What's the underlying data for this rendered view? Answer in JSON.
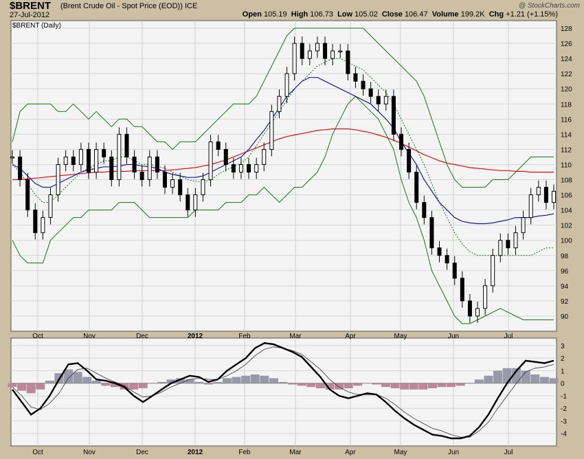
{
  "header": {
    "symbol": "$BRENT",
    "description": "(Brent Crude Oil - Spot Price (EOD))",
    "exchange": "ICE",
    "date": "27-Jul-2012",
    "open_label": "Open",
    "open": "105.19",
    "high_label": "High",
    "high": "106.73",
    "low_label": "Low",
    "low": "105.02",
    "close_label": "Close",
    "close": "106.47",
    "volume_label": "Volume",
    "volume": "199.2K",
    "chg_label": "Chg",
    "chg": "+1.21 (+1.15%)",
    "logo": "@ StockCharts.com"
  },
  "chart_data": [
    {
      "type": "line",
      "legend_label": "$BRENT (Daily)",
      "x_labels": [
        "Oct",
        "Nov",
        "Dec",
        "2012",
        "Feb",
        "Mar",
        "Apr",
        "May",
        "Jun",
        "Jul"
      ],
      "ylim": [
        88,
        129
      ],
      "y_ticks": [
        90,
        92,
        94,
        96,
        98,
        100,
        102,
        104,
        106,
        108,
        110,
        112,
        114,
        116,
        118,
        120,
        122,
        124,
        126,
        128
      ],
      "grid": true,
      "series": [
        {
          "role": "price",
          "values": [
            111,
            108,
            104,
            101,
            103,
            106,
            110,
            111,
            110,
            112,
            109,
            112,
            111,
            108,
            114,
            111,
            109,
            108,
            111,
            109,
            107,
            108,
            106,
            104,
            106,
            108,
            113,
            112,
            110,
            109,
            110,
            109,
            110,
            112,
            117,
            119,
            122,
            126,
            124,
            125,
            126,
            124,
            125,
            125,
            122,
            121,
            120,
            119,
            118,
            119,
            114,
            112,
            109,
            105,
            103,
            99,
            98,
            97,
            95,
            92,
            90,
            91,
            94,
            98,
            100,
            99,
            101,
            103,
            106,
            107,
            105,
            106.47
          ]
        },
        {
          "role": "sma50",
          "values": [
            110,
            109.5,
            108.5,
            107.5,
            107,
            107,
            107.5,
            108,
            108.5,
            109,
            109.3,
            109.5,
            109.7,
            109.7,
            109.8,
            110,
            110,
            109.8,
            109.7,
            109.5,
            109,
            108.7,
            108.5,
            108.3,
            108.3,
            108.5,
            109,
            109.5,
            110,
            110.5,
            111,
            112,
            113.3,
            114.5,
            116,
            117.5,
            119,
            120,
            121,
            121.5,
            121.5,
            121,
            120.5,
            120,
            119.5,
            119,
            118.5,
            118,
            117,
            116,
            114.8,
            113,
            111.5,
            110,
            108,
            106.5,
            105,
            104,
            103,
            102.5,
            102.3,
            102.2,
            102.2,
            102.3,
            102.5,
            102.7,
            103,
            103,
            103,
            103.2,
            103.3,
            103.5
          ]
        },
        {
          "role": "sma200",
          "values": [
            108,
            108,
            108.1,
            108.2,
            108.3,
            108.4,
            108.5,
            108.6,
            108.7,
            108.8,
            108.9,
            109,
            109,
            109.1,
            109.1,
            109.1,
            109.2,
            109.2,
            109.2,
            109.2,
            109.2,
            109.3,
            109.4,
            109.5,
            109.6,
            109.8,
            110,
            110.3,
            110.6,
            111,
            111.4,
            111.8,
            112.2,
            112.6,
            113,
            113.4,
            113.7,
            113.9,
            114.1,
            114.3,
            114.5,
            114.6,
            114.7,
            114.7,
            114.7,
            114.6,
            114.4,
            114.2,
            113.9,
            113.6,
            113.2,
            112.8,
            112.3,
            111.8,
            111.3,
            110.9,
            110.5,
            110.2,
            110,
            109.8,
            109.6,
            109.5,
            109.4,
            109.3,
            109.2,
            109.2,
            109.1,
            109.1,
            109,
            109,
            109,
            109
          ]
        },
        {
          "role": "bb_upper",
          "values": [
            113,
            117,
            118,
            118,
            118,
            118,
            117,
            117,
            118,
            117,
            116,
            117,
            116,
            115,
            116,
            116,
            115,
            115,
            114,
            113,
            113,
            112,
            113,
            113,
            113,
            114,
            115,
            116,
            117,
            118,
            118,
            118,
            119,
            121,
            123,
            125,
            127,
            128,
            128,
            128,
            128,
            128,
            128,
            128,
            128,
            128,
            128,
            127,
            126,
            125,
            124,
            123,
            122,
            121,
            119,
            116,
            113,
            110,
            108,
            107,
            107,
            107,
            107,
            108,
            108,
            108,
            109,
            110,
            111,
            111,
            111,
            111
          ]
        },
        {
          "role": "bb_lower",
          "values": [
            100,
            98,
            97,
            97,
            97,
            100,
            101,
            102,
            103,
            103,
            104,
            104,
            104,
            104,
            105,
            105,
            105,
            104,
            103,
            103,
            103,
            103,
            103,
            103,
            104,
            104,
            104,
            104,
            105,
            105,
            105,
            106,
            106,
            107,
            106,
            105,
            106,
            107,
            107,
            108,
            109,
            111,
            114,
            116,
            118,
            119,
            118,
            117,
            116,
            114,
            112,
            108,
            105,
            103,
            100,
            96,
            94,
            92,
            90,
            89,
            89,
            89.5,
            90,
            90.5,
            91,
            90.5,
            90,
            89.5,
            89.5,
            89.5,
            89.5,
            89.5
          ]
        },
        {
          "role": "ema",
          "values": [
            110,
            109,
            107.5,
            106,
            105,
            105,
            106,
            107,
            108,
            109,
            109.5,
            110,
            110.5,
            110.5,
            111,
            111,
            110.5,
            110,
            110,
            109.8,
            109.5,
            109,
            108.5,
            108,
            107.8,
            107.7,
            108,
            108.7,
            109.3,
            109.7,
            110.2,
            111,
            112.5,
            114,
            115.5,
            117,
            118.5,
            120,
            121,
            122,
            123,
            123.5,
            124,
            124,
            123.5,
            123,
            122.5,
            121.5,
            120.5,
            119.5,
            118,
            116,
            114,
            112,
            110,
            107.5,
            105,
            103,
            101,
            99.5,
            98.5,
            98,
            98,
            98,
            98,
            98,
            98,
            98,
            98,
            98.5,
            99,
            99
          ]
        }
      ]
    },
    {
      "type": "line",
      "x_labels": [
        "Oct",
        "Nov",
        "Dec",
        "2012",
        "Feb",
        "Mar",
        "Apr",
        "May",
        "Jun",
        "Jul"
      ],
      "ylim": [
        -5,
        3.6
      ],
      "y_ticks": [
        3,
        2,
        1,
        0,
        -1,
        -2,
        -3,
        -4
      ],
      "grid": true,
      "series": [
        {
          "role": "macd",
          "values": [
            -0.5,
            -1.5,
            -2.5,
            -2,
            -1,
            0.3,
            1.5,
            1.6,
            1,
            0.3,
            0.2,
            0,
            -0.3,
            -1,
            -1.5,
            -1,
            -0.5,
            0,
            0.3,
            0.6,
            0.5,
            0.1,
            0.3,
            1,
            1.5,
            2,
            2.8,
            3.2,
            3.1,
            2.8,
            2.5,
            2.1,
            1.3,
            0.5,
            -0.5,
            -1,
            -1.2,
            -1,
            -0.8,
            -0.9,
            -1.5,
            -2.2,
            -2.8,
            -3.3,
            -3.7,
            -4.1,
            -4.2,
            -4.4,
            -4.4,
            -4.2,
            -3.5,
            -2.5,
            -1.2,
            0,
            1,
            1.8,
            1.7,
            1.6,
            1.8
          ]
        },
        {
          "role": "signal",
          "values": [
            -0.3,
            -1,
            -1.9,
            -2.1,
            -1.6,
            -0.8,
            0.4,
            1.1,
            1.2,
            0.8,
            0.4,
            0.1,
            -0.2,
            -0.7,
            -1.1,
            -1,
            -0.7,
            -0.3,
            0,
            0.3,
            0.4,
            0.3,
            0.3,
            0.6,
            1,
            1.5,
            2.2,
            2.7,
            2.9,
            2.8,
            2.6,
            2.3,
            1.7,
            1.1,
            0.3,
            -0.3,
            -0.7,
            -0.9,
            -0.9,
            -0.9,
            -1.2,
            -1.7,
            -2.3,
            -2.8,
            -3.2,
            -3.6,
            -3.8,
            -4.1,
            -4.3,
            -4.3,
            -3.8,
            -3.1,
            -2,
            -1,
            0,
            0.9,
            1.2,
            1.3,
            1.5
          ]
        },
        {
          "role": "histogram",
          "values": [
            -0.3,
            -0.6,
            -0.8,
            -0.5,
            0.2,
            0.8,
            1.1,
            0.9,
            0.5,
            0.2,
            -0.2,
            -0.3,
            -0.5,
            -0.5,
            -0.4,
            0,
            0.1,
            0.3,
            0.4,
            0.3,
            0.1,
            -0.1,
            0.1,
            0.4,
            0.5,
            0.6,
            0.7,
            0.6,
            0.4,
            0.1,
            -0.1,
            -0.2,
            -0.3,
            -0.4,
            -0.5,
            -0.5,
            -0.4,
            -0.2,
            0,
            -0.1,
            -0.3,
            -0.4,
            -0.5,
            -0.5,
            -0.5,
            -0.4,
            -0.3,
            -0.3,
            -0.2,
            0,
            0.3,
            0.6,
            1,
            1.2,
            1.2,
            1,
            0.7,
            0.5,
            0.4
          ]
        }
      ]
    }
  ],
  "colors": {
    "price": "#000000",
    "sma50": "#1a1a99",
    "sma200": "#dd1111",
    "bands": "#117711",
    "ema": "#117711",
    "hist_pos": "#9999aa",
    "hist_neg": "#bb8899",
    "panel_bg": "#f4f4f4"
  }
}
